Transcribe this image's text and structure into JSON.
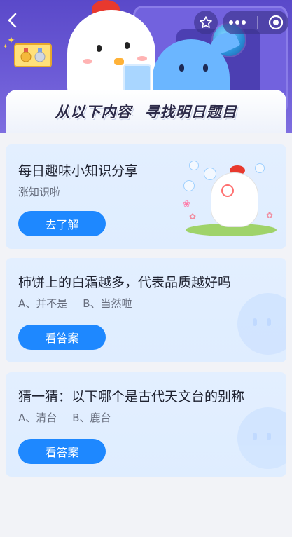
{
  "nav": {
    "back_glyph": "‹",
    "favorite_icon": "star-icon",
    "more_icon": "more-dots-icon",
    "close_icon": "target-circle-icon"
  },
  "banner": {
    "title": "从以下内容 寻找明日题目"
  },
  "cards": [
    {
      "title": "每日趣味小知识分享",
      "subtitle": "涨知识啦",
      "button": "去了解"
    },
    {
      "title": "柿饼上的白霜越多，代表品质越好吗",
      "option_a": "A、并不是",
      "option_b": "B、当然啦",
      "button": "看答案"
    },
    {
      "title": "猜一猜：以下哪个是古代天文台的别称",
      "option_a": "A、清台",
      "option_b": "B、鹿台",
      "button": "看答案"
    }
  ],
  "colors": {
    "hero_purple": "#5a49c9",
    "button_blue": "#1e88ff",
    "card_bg": "#e3efff",
    "page_bg": "#f2f3f7"
  }
}
